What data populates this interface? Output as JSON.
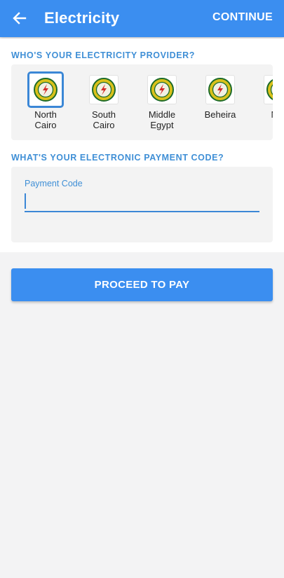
{
  "header": {
    "title": "Electricity",
    "continue_label": "CONTINUE",
    "background_color": "#3b8ef0"
  },
  "provider_section": {
    "label": "WHO'S YOUR ELECTRICITY PROVIDER?",
    "providers": [
      {
        "line1": "North",
        "line2": "Cairo",
        "selected": true
      },
      {
        "line1": "South",
        "line2": "Cairo",
        "selected": false
      },
      {
        "line1": "Middle",
        "line2": "Egypt",
        "selected": false
      },
      {
        "line1": "Beheira",
        "line2": "",
        "selected": false
      },
      {
        "line1": "Nor",
        "line2": "",
        "selected": false
      }
    ]
  },
  "payment_section": {
    "label": "WHAT'S YOUR ELECTRONIC PAYMENT CODE?",
    "field_label": "Payment Code",
    "field_value": ""
  },
  "actions": {
    "proceed_label": "PROCEED TO PAY"
  }
}
